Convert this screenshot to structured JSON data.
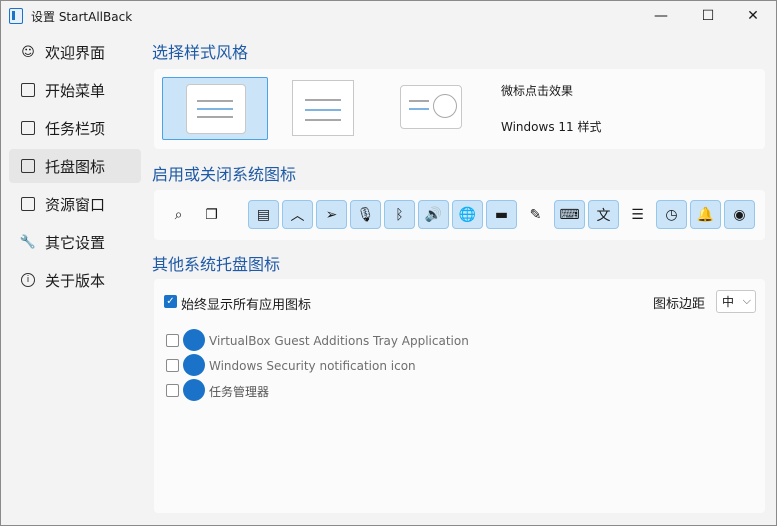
{
  "window": {
    "title": "设置 StartAllBack",
    "minimize_glyph": "—",
    "maximize_glyph": "☐",
    "close_glyph": "✕"
  },
  "sidebar": {
    "items": [
      {
        "label": "欢迎界面",
        "icon": "smiley-icon",
        "active": false
      },
      {
        "label": "开始菜单",
        "icon": "start-menu-icon",
        "active": false
      },
      {
        "label": "任务栏项",
        "icon": "taskbar-icon",
        "active": false
      },
      {
        "label": "托盘图标",
        "icon": "tray-icon",
        "active": true
      },
      {
        "label": "资源窗口",
        "icon": "folder-icon",
        "active": false
      },
      {
        "label": "其它设置",
        "icon": "wrench-icon",
        "active": false
      },
      {
        "label": "关于版本",
        "icon": "info-icon",
        "active": false
      }
    ]
  },
  "style_section": {
    "heading": "选择样式风格",
    "option_label_1": "微标点击效果",
    "option_label_2": "Windows 11 样式"
  },
  "system_icons_section": {
    "heading": "启用或关闭系统图标",
    "icons": [
      {
        "name": "search-icon",
        "glyph": "⌕",
        "on": false
      },
      {
        "name": "task-view-icon",
        "glyph": "❐",
        "on": false
      },
      {
        "name": "input-panel-icon",
        "glyph": "▤",
        "on": true
      },
      {
        "name": "chevron-up-icon",
        "glyph": "︿",
        "on": true
      },
      {
        "name": "location-icon",
        "glyph": "➢",
        "on": true
      },
      {
        "name": "microphone-icon",
        "glyph": "🎙",
        "on": true
      },
      {
        "name": "bluetooth-icon",
        "glyph": "ᛒ",
        "on": true
      },
      {
        "name": "volume-icon",
        "glyph": "🔊",
        "on": true
      },
      {
        "name": "network-globe-icon",
        "glyph": "🌐",
        "on": true
      },
      {
        "name": "battery-icon",
        "glyph": "▬",
        "on": true
      },
      {
        "name": "pen-icon",
        "glyph": "✎",
        "on": false
      },
      {
        "name": "keyboard-icon",
        "glyph": "⌨",
        "on": true
      },
      {
        "name": "language-icon",
        "glyph": "文",
        "on": true
      },
      {
        "name": "equalizer-icon",
        "glyph": "☰",
        "on": false
      },
      {
        "name": "clock-icon",
        "glyph": "◷",
        "on": true
      },
      {
        "name": "bell-icon",
        "glyph": "🔔",
        "on": true
      },
      {
        "name": "eye-icon",
        "glyph": "◉",
        "on": true
      }
    ]
  },
  "other_tray_section": {
    "heading": "其他系统托盘图标",
    "always_show_label": "始终显示所有应用图标",
    "always_show_checked": true,
    "margin_label": "图标边距",
    "margin_value": "中",
    "apps": [
      {
        "label": "VirtualBox Guest Additions Tray Application",
        "icon": "virtualbox-icon",
        "checked": false
      },
      {
        "label": "Windows Security notification icon",
        "icon": "windows-security-icon",
        "checked": false
      },
      {
        "label": "任务管理器",
        "icon": "task-manager-icon",
        "checked": false
      }
    ]
  }
}
